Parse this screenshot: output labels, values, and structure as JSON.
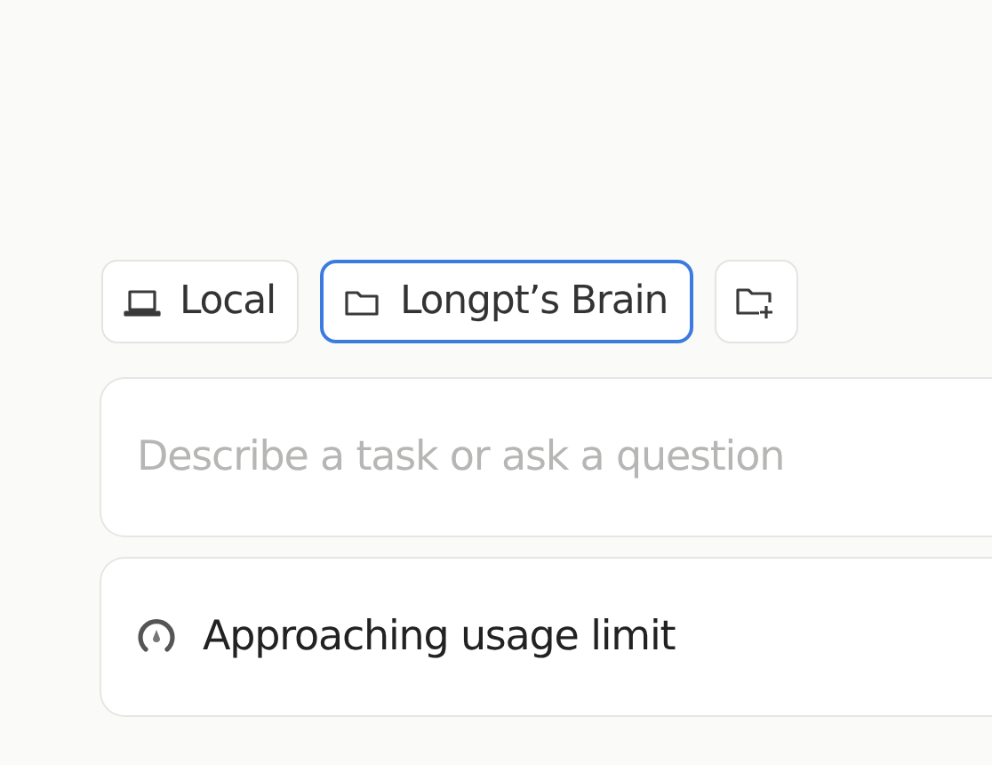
{
  "locations": [
    {
      "kind": "computer",
      "label": "Local",
      "selected": false
    },
    {
      "kind": "folder",
      "label": "Longpt’s Brain",
      "selected": true
    }
  ],
  "task_input": {
    "placeholder": "Describe a task or ask a question"
  },
  "usage_notice": {
    "text": "Approaching usage limit"
  }
}
